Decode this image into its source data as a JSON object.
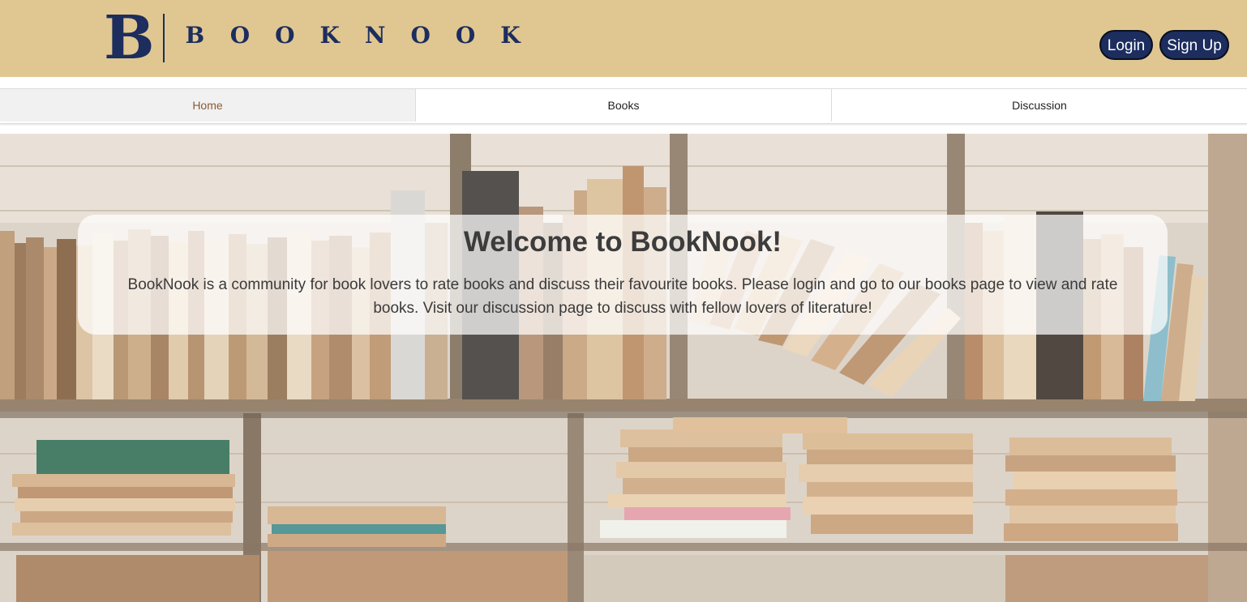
{
  "header": {
    "logo_mark": "B",
    "logo_word": "BOOKNOOK",
    "login_label": "Login",
    "signup_label": "Sign Up"
  },
  "nav": {
    "tabs": [
      {
        "label": "Home",
        "active": true
      },
      {
        "label": "Books",
        "active": false
      },
      {
        "label": "Discussion",
        "active": false
      }
    ]
  },
  "hero": {
    "title": "Welcome to BookNook!",
    "text": "BookNook is a community for book lovers to rate books and discuss their favourite books. Please login and go to our books page to view and rate books. Visit our discussion page to discuss with fellow lovers of literature!"
  },
  "colors": {
    "header_bg": "#e0c792",
    "brand_navy": "#1c2d5e",
    "active_tab_text": "#8a5a32"
  }
}
